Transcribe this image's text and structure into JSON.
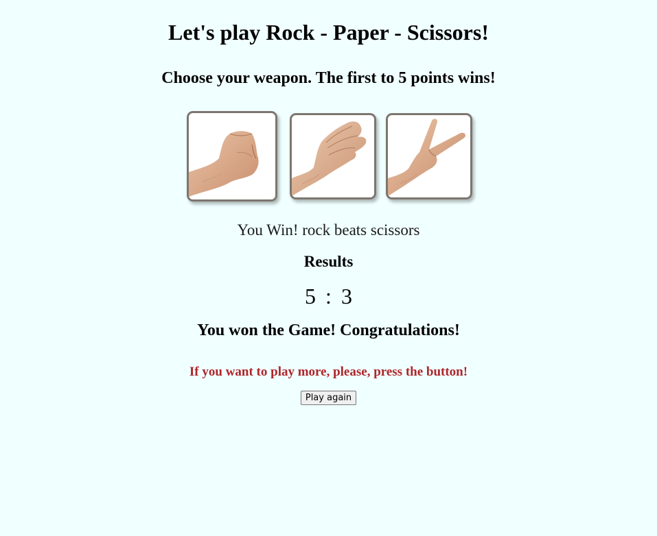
{
  "title": "Let's play Rock - Paper - Scissors!",
  "subtitle": "Choose your weapon. The first to 5 points wins!",
  "weapons": [
    {
      "name": "rock",
      "icon": "rock-hand-icon"
    },
    {
      "name": "paper",
      "icon": "paper-hand-icon"
    },
    {
      "name": "scissors",
      "icon": "scissors-hand-icon"
    }
  ],
  "round_message": "You Win! rock beats scissors",
  "results": {
    "title": "Results",
    "player_score": "5",
    "separator": ":",
    "computer_score": "3"
  },
  "final_message": "You won the Game! Congratulations!",
  "hint": "If you want to play more, please, press the button!",
  "play_again_label": "Play again",
  "colors": {
    "background": "#f0ffff",
    "hint_text": "#b0252a",
    "card_border": "#7d766f",
    "skin": "#e6b898"
  }
}
